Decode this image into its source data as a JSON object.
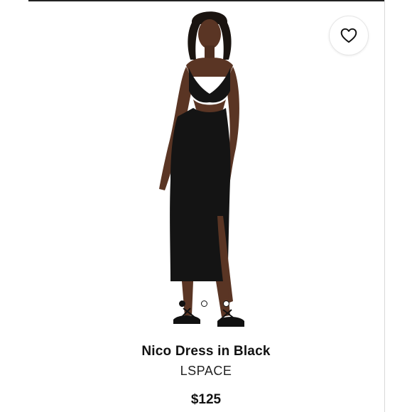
{
  "product": {
    "name": "Nico Dress in Black",
    "brand": "LSPACE",
    "price": "$125",
    "image_description": "Model wearing black sleeveless ribbed midi dress with cutout and side slit, black strappy sandals",
    "colors": {
      "text": "#111111",
      "dress": "#141414",
      "skin": "#5a3524"
    }
  },
  "favorite": {
    "icon": "heart-outline-icon"
  },
  "carousel": {
    "total": 3,
    "active_index": 0
  }
}
